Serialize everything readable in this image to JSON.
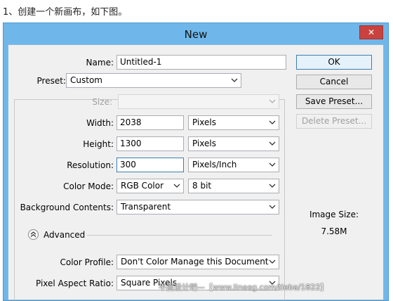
{
  "caption": "1、创建一个新画布，如下图。",
  "dialog": {
    "title": "New",
    "close_label": "✕"
  },
  "form": {
    "name_label": "Name:",
    "name_value": "Untitled-1",
    "preset_label": "Preset:",
    "preset_value": "Custom",
    "size_label": "Size:",
    "size_value": "",
    "width_label": "Width:",
    "width_value": "2038",
    "width_unit": "Pixels",
    "height_label": "Height:",
    "height_value": "1300",
    "height_unit": "Pixels",
    "resolution_label": "Resolution:",
    "resolution_value": "300",
    "resolution_unit": "Pixels/Inch",
    "color_mode_label": "Color Mode:",
    "color_mode_value": "RGB Color",
    "bit_depth_value": "8 bit",
    "background_label": "Background Contents:",
    "background_value": "Transparent",
    "advanced_label": "Advanced",
    "color_profile_label": "Color Profile:",
    "color_profile_value": "Don't Color Manage this Document",
    "pixel_aspect_label": "Pixel Aspect Ratio:",
    "pixel_aspect_value": "Square Pixels"
  },
  "buttons": {
    "ok": "OK",
    "cancel": "Cancel",
    "save_preset": "Save Preset...",
    "delete_preset": "Delete Preset..."
  },
  "image_size": {
    "label": "Image Size:",
    "value": "7.58M"
  },
  "watermark": "平面设计吧—【www.lineeg.com/tieba/1822】",
  "icons": {
    "chevron": "chevron-down-icon",
    "advanced": "collapse-up-icon",
    "close": "close-icon"
  },
  "colors": {
    "titlebar": "#6fb7ea",
    "close_button": "#c9423e",
    "panel": "#f0f0f0"
  }
}
